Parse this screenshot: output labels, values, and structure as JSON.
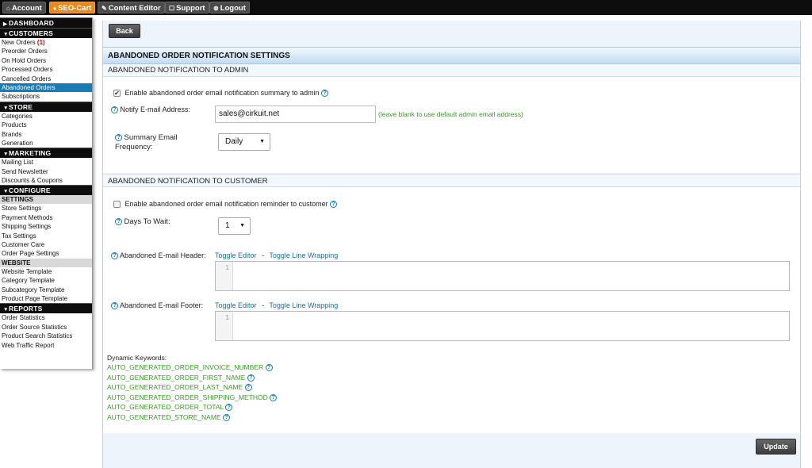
{
  "topbar": {
    "items": [
      {
        "label": "Account",
        "icon": "home-icon",
        "glyph": "⌂"
      },
      {
        "label": "SEO-Cart",
        "icon": "seo-cart-logo-icon",
        "glyph": "♦"
      },
      {
        "label": "Content Editor",
        "icon": "pencil-icon",
        "glyph": "✎"
      },
      {
        "label": "Support",
        "icon": "support-icon",
        "glyph": "☐"
      },
      {
        "label": "Logout",
        "icon": "close-circle-icon",
        "glyph": "⊗"
      }
    ],
    "active_color": "#e8891a"
  },
  "sidebar": {
    "dashboard": "DASHBOARD",
    "customers": {
      "title": "CUSTOMERS",
      "items": [
        "New Orders",
        "Preorder Orders",
        "On Hold Orders",
        "Processed Orders",
        "Cancelled Orders",
        "Abandoned Orders",
        "Subscriptions"
      ],
      "new_orders_count": "(1)"
    },
    "store": {
      "title": "STORE",
      "items": [
        "Categories",
        "Products",
        "Brands",
        "Generation"
      ]
    },
    "marketing": {
      "title": "MARKETING",
      "items": [
        "Mailing List",
        "Send Newsletter",
        "Discounts & Coupons"
      ]
    },
    "configure": {
      "title": "CONFIGURE",
      "settings_label": "SETTINGS",
      "settings_items": [
        "Store Settings",
        "Payment Methods",
        "Shipping Settings",
        "Tax Settings",
        "Customer Care",
        "Order Page Settings"
      ],
      "website_label": "WEBSITE",
      "website_items": [
        "Website Template",
        "Category Template",
        "Subcategory Template",
        "Product Page Template"
      ]
    },
    "reports": {
      "title": "REPORTS",
      "items": [
        "Order Statistics",
        "Order Source Statistics",
        "Product Search Statistics",
        "Web Traffic Report"
      ]
    }
  },
  "main": {
    "back_label": "Back",
    "title": "ABANDONED ORDER NOTIFICATION SETTINGS",
    "admin": {
      "heading": "ABANDONED NOTIFICATION TO ADMIN",
      "enable_label": "Enable abandoned order email notification summary to admin",
      "enable_checked": true,
      "notify_label": "Notify E-mail Address:",
      "notify_value": "sales@cirkuit.net",
      "notify_hint": "(leave blank to use default admin email address)",
      "frequency_label_1": "Summary Email",
      "frequency_label_2": "Frequency:",
      "frequency_value": "Daily"
    },
    "customer": {
      "heading": "ABANDONED NOTIFICATION TO CUSTOMER",
      "enable_label": "Enable abandoned order email notification reminder to customer",
      "enable_checked": false,
      "days_label": "Days To Wait:",
      "days_value": "1",
      "header_label": "Abandoned E-mail Header:",
      "footer_label": "Abandoned E-mail Footer:",
      "toggle_editor": "Toggle Editor",
      "separator": "-",
      "toggle_wrap": "Toggle Line Wrapping",
      "line_number": "1"
    },
    "keywords": {
      "title": "Dynamic Keywords:",
      "items": [
        "AUTO_GENERATED_ORDER_INVOICE_NUMBER",
        "AUTO_GENERATED_ORDER_FIRST_NAME",
        "AUTO_GENERATED_ORDER_LAST_NAME",
        "AUTO_GENERATED_ORDER_SHIPPING_METHOD",
        "AUTO_GENERATED_ORDER_TOTAL",
        "AUTO_GENERATED_STORE_NAME"
      ]
    },
    "update_label": "Update"
  }
}
